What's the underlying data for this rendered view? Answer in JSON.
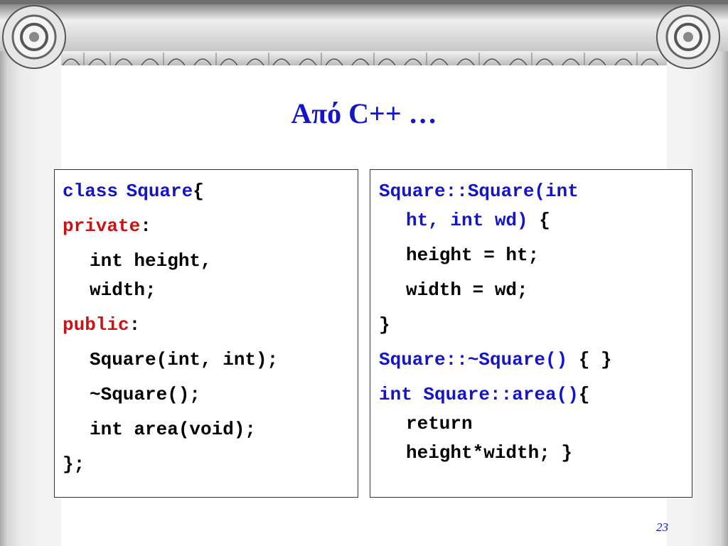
{
  "slide": {
    "title": "Από C++ …",
    "page_number": "23"
  },
  "left_code": {
    "l1_kw": "class",
    "l1_name": "Square",
    "l1_brace": "{",
    "l2_kw": "private",
    "l2_colon": ":",
    "l3a": "int height,",
    "l3b": "width;",
    "l4_kw": "public",
    "l4_colon": ":",
    "l5": "Square(int, int);",
    "l6": "~Square();",
    "l7": "int area(void);",
    "l8": "};"
  },
  "right_code": {
    "r1a": "Square::Square(int",
    "r1b": "ht, int wd)",
    "r1b_brace": " {",
    "r2": "height = ht;",
    "r3": "width = wd;",
    "r4": "}",
    "r5_sig": "Square::~Square()",
    "r5_body": " { }",
    "r6_kw": "int",
    "r6_sig": " Square::area()",
    "r6_brace": "{",
    "r7a": "return",
    "r7b": "height*width; }"
  },
  "colors": {
    "keyword_blue": "#1515c8",
    "access_red": "#c81414",
    "title_blue": "#1515c8"
  }
}
